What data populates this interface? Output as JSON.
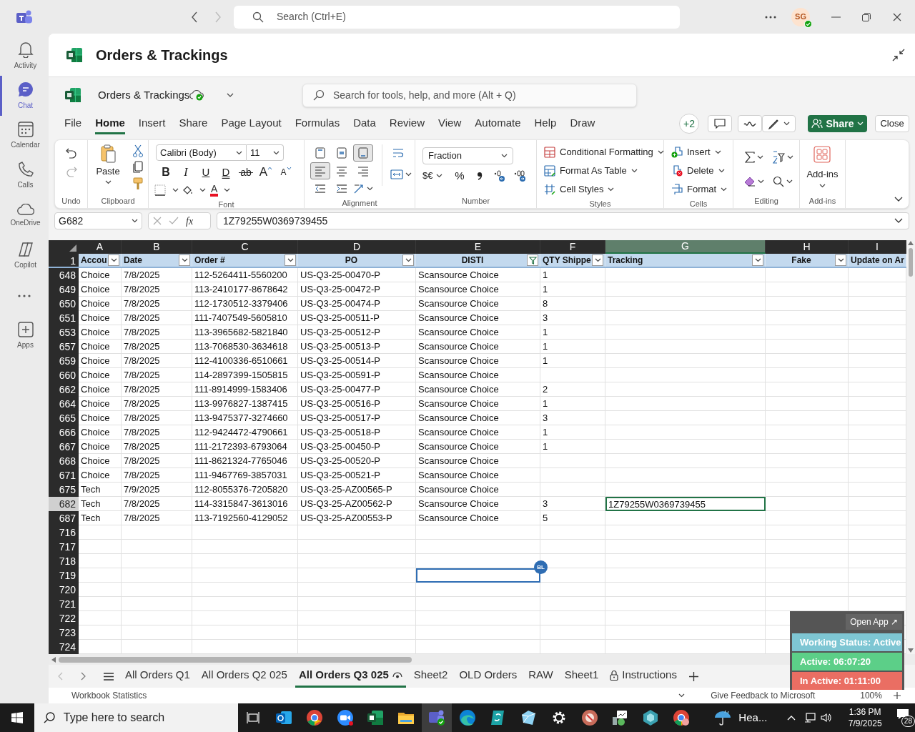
{
  "teams_bar": {
    "search_placeholder": "Search (Ctrl+E)",
    "avatar_initials": "SG"
  },
  "rail": [
    {
      "label": "Activity",
      "selected": false
    },
    {
      "label": "Chat",
      "selected": true
    },
    {
      "label": "Calendar",
      "selected": false
    },
    {
      "label": "Calls",
      "selected": false
    },
    {
      "label": "OneDrive",
      "selected": false
    },
    {
      "label": "Copilot",
      "selected": false
    },
    {
      "label": "Apps",
      "selected": false
    }
  ],
  "document": {
    "title": "Orders & Trackings"
  },
  "workbook": {
    "file_name": "Orders & Trackings",
    "search_placeholder": "Search for tools, help, and more (Alt + Q)"
  },
  "menu_tabs": [
    {
      "label": "File",
      "selected": false
    },
    {
      "label": "Home",
      "selected": true
    },
    {
      "label": "Insert",
      "selected": false
    },
    {
      "label": "Share",
      "selected": false
    },
    {
      "label": "Page Layout",
      "selected": false
    },
    {
      "label": "Formulas",
      "selected": false
    },
    {
      "label": "Data",
      "selected": false
    },
    {
      "label": "Review",
      "selected": false
    },
    {
      "label": "View",
      "selected": false
    },
    {
      "label": "Automate",
      "selected": false
    },
    {
      "label": "Help",
      "selected": false
    },
    {
      "label": "Draw",
      "selected": false
    }
  ],
  "toolbar": {
    "coauthors": "+2",
    "share_label": "Share",
    "close_label": "Close"
  },
  "ribbon": {
    "groups": [
      "Undo",
      "Clipboard",
      "Font",
      "Alignment",
      "Number",
      "Styles",
      "Cells",
      "Editing",
      "Add-ins"
    ],
    "paste_label": "Paste",
    "font_name": "Calibri (Body)",
    "font_size": "11",
    "font_buttons": [
      "B",
      "I",
      "U",
      "D",
      "ab",
      "A",
      "A"
    ],
    "font_color_letter": "A",
    "vertical_align": [
      {
        "selected": false
      },
      {
        "selected": false
      },
      {
        "selected": true
      }
    ],
    "horizontal_align": [
      {
        "selected": true
      },
      {
        "selected": false
      },
      {
        "selected": false
      }
    ],
    "number_format": "Fraction",
    "currency_label": "$€",
    "percent_label": "%",
    "style_buttons": [
      "Conditional Formatting",
      "Format As Table",
      "Cell Styles"
    ],
    "cell_buttons": [
      "Insert",
      "Delete",
      "Format"
    ],
    "addins_label": "Add-ins"
  },
  "formula_bar": {
    "name_box": "G682",
    "fx_label": "fx",
    "value": "1Z79255W0369739455"
  },
  "sheet": {
    "columns": [
      {
        "letter": "A",
        "header": "Accou",
        "centered": false,
        "filtered": false,
        "selected": false
      },
      {
        "letter": "B",
        "header": "Date",
        "centered": false,
        "filtered": false,
        "selected": false
      },
      {
        "letter": "C",
        "header": "Order #",
        "centered": false,
        "filtered": false,
        "selected": false
      },
      {
        "letter": "D",
        "header": "PO",
        "centered": true,
        "filtered": false,
        "selected": false
      },
      {
        "letter": "E",
        "header": "DISTI",
        "centered": true,
        "filtered": true,
        "selected": false
      },
      {
        "letter": "F",
        "header": "QTY Shippe",
        "centered": false,
        "filtered": false,
        "selected": false
      },
      {
        "letter": "G",
        "header": "Tracking",
        "centered": false,
        "filtered": false,
        "selected": true
      },
      {
        "letter": "H",
        "header": "Fake",
        "centered": true,
        "filtered": false,
        "selected": false
      },
      {
        "letter": "I",
        "header": "Update on Ar",
        "centered": false,
        "selected": false
      }
    ],
    "header_row_number": "1",
    "rows": [
      {
        "number": "648",
        "selected": false,
        "cells": {
          "A": "Choice",
          "B": "7/8/2025",
          "C": "112-5264411-5560200",
          "D": "US-Q3-25-00470-P",
          "E": "Scansource Choice",
          "F": "1"
        }
      },
      {
        "number": "649",
        "selected": false,
        "cells": {
          "A": "Choice",
          "B": "7/8/2025",
          "C": "113-2410177-8678642",
          "D": "US-Q3-25-00472-P",
          "E": "Scansource Choice",
          "F": "1"
        }
      },
      {
        "number": "650",
        "selected": false,
        "cells": {
          "A": "Choice",
          "B": "7/8/2025",
          "C": "112-1730512-3379406",
          "D": "US-Q3-25-00474-P",
          "E": "Scansource Choice",
          "F": "8"
        }
      },
      {
        "number": "651",
        "selected": false,
        "cells": {
          "A": "Choice",
          "B": "7/8/2025",
          "C": "111-7407549-5605810",
          "D": "US-Q3-25-00511-P",
          "E": "Scansource Choice",
          "F": "3"
        }
      },
      {
        "number": "653",
        "selected": false,
        "cells": {
          "A": "Choice",
          "B": "7/8/2025",
          "C": "113-3965682-5821840",
          "D": "US-Q3-25-00512-P",
          "E": "Scansource Choice",
          "F": "1"
        }
      },
      {
        "number": "657",
        "selected": false,
        "cells": {
          "A": "Choice",
          "B": "7/8/2025",
          "C": "113-7068530-3634618",
          "D": "US-Q3-25-00513-P",
          "E": "Scansource Choice",
          "F": "1"
        }
      },
      {
        "number": "659",
        "selected": false,
        "cells": {
          "A": "Choice",
          "B": "7/8/2025",
          "C": "112-4100336-6510661",
          "D": "US-Q3-25-00514-P",
          "E": "Scansource Choice",
          "F": "1"
        }
      },
      {
        "number": "660",
        "selected": false,
        "cells": {
          "A": "Choice",
          "B": "7/8/2025",
          "C": "114-2897399-1505815",
          "D": "US-Q3-25-00591-P",
          "E": "Scansource Choice"
        }
      },
      {
        "number": "662",
        "selected": false,
        "cells": {
          "A": "Choice",
          "B": "7/8/2025",
          "C": "111-8914999-1583406",
          "D": "US-Q3-25-00477-P",
          "E": "Scansource Choice",
          "F": "2"
        }
      },
      {
        "number": "664",
        "selected": false,
        "cells": {
          "A": "Choice",
          "B": "7/8/2025",
          "C": "113-9976827-1387415",
          "D": "US-Q3-25-00516-P",
          "E": "Scansource Choice",
          "F": "1"
        }
      },
      {
        "number": "665",
        "selected": false,
        "cells": {
          "A": "Choice",
          "B": "7/8/2025",
          "C": "113-9475377-3274660",
          "D": "US-Q3-25-00517-P",
          "E": "Scansource Choice",
          "F": "3"
        }
      },
      {
        "number": "666",
        "selected": false,
        "cells": {
          "A": "Choice",
          "B": "7/8/2025",
          "C": "112-9424472-4790661",
          "D": "US-Q3-25-00518-P",
          "E": "Scansource Choice",
          "F": "1"
        }
      },
      {
        "number": "667",
        "selected": false,
        "cells": {
          "A": "Choice",
          "B": "7/8/2025",
          "C": "111-2172393-6793064",
          "D": "US-Q3-25-00450-P",
          "E": "Scansource Choice",
          "F": "1"
        }
      },
      {
        "number": "668",
        "selected": false,
        "cells": {
          "A": "Choice",
          "B": "7/8/2025",
          "C": "111-8621324-7765046",
          "D": "US-Q3-25-00520-P",
          "E": "Scansource Choice"
        }
      },
      {
        "number": "671",
        "selected": false,
        "cells": {
          "A": "Choice",
          "B": "7/8/2025",
          "C": "111-9467769-3857031",
          "D": "US-Q3-25-00521-P",
          "E": "Scansource Choice"
        }
      },
      {
        "number": "675",
        "selected": false,
        "cells": {
          "A": "Tech",
          "B": "7/9/2025",
          "C": "112-8055376-7205820",
          "D": "US-Q3-25-AZ00565-P",
          "E": "Scansource Choice"
        }
      },
      {
        "number": "682",
        "selected": true,
        "cells": {
          "A": "Tech",
          "B": "7/8/2025",
          "C": "114-3315847-3613016",
          "D": "US-Q3-25-AZ00562-P",
          "E": "Scansource Choice",
          "F": "3",
          "G": "1Z79255W0369739455"
        }
      },
      {
        "number": "687",
        "selected": false,
        "cells": {
          "A": "Tech",
          "B": "7/8/2025",
          "C": "113-7192560-4129052",
          "D": "US-Q3-25-AZ00553-P",
          "E": "Scansource Choice",
          "F": "5"
        }
      },
      {
        "number": "716",
        "selected": false
      },
      {
        "number": "717",
        "selected": false
      },
      {
        "number": "718",
        "selected": false
      },
      {
        "number": "719",
        "selected": false,
        "collaborators": {
          "E": "BL"
        }
      },
      {
        "number": "720",
        "selected": false
      },
      {
        "number": "721",
        "selected": false
      },
      {
        "number": "722",
        "selected": false
      },
      {
        "number": "723",
        "selected": false
      },
      {
        "number": "724",
        "selected": false
      }
    ]
  },
  "sheet_tabs": [
    {
      "label": "All Orders Q1",
      "selected": false,
      "kind": "plain"
    },
    {
      "label": "All Orders Q2 025",
      "selected": false,
      "kind": "plain"
    },
    {
      "label": "All Orders Q3 025",
      "selected": true,
      "kind": "viewing"
    },
    {
      "label": "Sheet2",
      "selected": false,
      "kind": "plain"
    },
    {
      "label": "OLD Orders",
      "selected": false,
      "kind": "plain"
    },
    {
      "label": "RAW",
      "selected": false,
      "kind": "plain"
    },
    {
      "label": "Sheet1",
      "selected": false,
      "kind": "plain"
    },
    {
      "label": "Instructions",
      "selected": false,
      "kind": "locked"
    }
  ],
  "status_bar": {
    "left": "Workbook Statistics",
    "feedback": "Give Feedback to Microsoft",
    "zoom": "100%"
  },
  "tracker_widget": {
    "open_app": "Open App ↗",
    "statuses": [
      {
        "label": "Working Status: Active",
        "color": "#7ec6d3"
      },
      {
        "label": "Active: 06:07:20",
        "color": "#5ccf88"
      },
      {
        "label": "In Active: 01:11:00",
        "color": "#ea6e63"
      }
    ]
  },
  "taskbar": {
    "search_placeholder": "Type here to search",
    "apps": [
      {
        "selected": false
      },
      {
        "selected": false
      },
      {
        "selected": false
      },
      {
        "selected": false
      },
      {
        "selected": false
      },
      {
        "selected": true
      },
      {
        "selected": false
      },
      {
        "selected": false
      },
      {
        "selected": false
      },
      {
        "selected": false
      },
      {
        "selected": false
      },
      {
        "selected": false
      },
      {
        "selected": false
      },
      {
        "selected": false
      }
    ],
    "weather": "Hea...",
    "time": "1:36 PM",
    "date": "7/9/2025",
    "notifications": "28"
  }
}
